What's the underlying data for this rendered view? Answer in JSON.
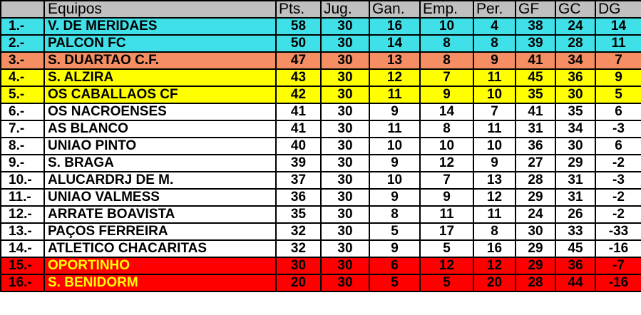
{
  "headers": {
    "pos": "",
    "team": "Equipos",
    "pts": "Pts.",
    "jug": "Jug.",
    "gan": "Gan.",
    "emp": "Emp.",
    "per": "Per.",
    "gf": "GF",
    "gc": "GC",
    "dg": "DG"
  },
  "colors": {
    "cyan": "#3fe0e8",
    "orange": "#f58e62",
    "yellow": "#ffff00",
    "white": "#ffffff",
    "red": "#ff0000",
    "header": "#c0c0c0"
  },
  "rows": [
    {
      "pos": "1.-",
      "team": "V. DE MERIDAES",
      "pts": "58",
      "jug": "30",
      "gan": "16",
      "emp": "10",
      "per": "4",
      "gf": "38",
      "gc": "24",
      "dg": "14",
      "zone": "cyan"
    },
    {
      "pos": "2.-",
      "team": "PALCON FC",
      "pts": "50",
      "jug": "30",
      "gan": "14",
      "emp": "8",
      "per": "8",
      "gf": "39",
      "gc": "28",
      "dg": "11",
      "zone": "cyan"
    },
    {
      "pos": "3.-",
      "team": "S. DUARTAO C.F.",
      "pts": "47",
      "jug": "30",
      "gan": "13",
      "emp": "8",
      "per": "9",
      "gf": "41",
      "gc": "34",
      "dg": "7",
      "zone": "orange"
    },
    {
      "pos": "4.-",
      "team": "S. ALZIRA",
      "pts": "43",
      "jug": "30",
      "gan": "12",
      "emp": "7",
      "per": "11",
      "gf": "45",
      "gc": "36",
      "dg": "9",
      "zone": "yellow"
    },
    {
      "pos": "5.-",
      "team": "OS CABALLAOS CF",
      "pts": "42",
      "jug": "30",
      "gan": "11",
      "emp": "9",
      "per": "10",
      "gf": "35",
      "gc": "30",
      "dg": "5",
      "zone": "yellow"
    },
    {
      "pos": "6.-",
      "team": "OS NACROENSES",
      "pts": "41",
      "jug": "30",
      "gan": "9",
      "emp": "14",
      "per": "7",
      "gf": "41",
      "gc": "35",
      "dg": "6",
      "zone": "white"
    },
    {
      "pos": "7.-",
      "team": "AS BLANCO",
      "pts": "41",
      "jug": "30",
      "gan": "11",
      "emp": "8",
      "per": "11",
      "gf": "31",
      "gc": "34",
      "dg": "-3",
      "zone": "white"
    },
    {
      "pos": "8.-",
      "team": "UNIAO PINTO",
      "pts": "40",
      "jug": "30",
      "gan": "10",
      "emp": "10",
      "per": "10",
      "gf": "36",
      "gc": "30",
      "dg": "6",
      "zone": "white"
    },
    {
      "pos": "9.-",
      "team": "S. BRAGA",
      "pts": "39",
      "jug": "30",
      "gan": "9",
      "emp": "12",
      "per": "9",
      "gf": "27",
      "gc": "29",
      "dg": "-2",
      "zone": "white"
    },
    {
      "pos": "10.-",
      "team": "ALUCARDRJ DE M.",
      "pts": "37",
      "jug": "30",
      "gan": "10",
      "emp": "7",
      "per": "13",
      "gf": "28",
      "gc": "31",
      "dg": "-3",
      "zone": "white"
    },
    {
      "pos": "11.-",
      "team": "UNIAO VALMESS",
      "pts": "36",
      "jug": "30",
      "gan": "9",
      "emp": "9",
      "per": "12",
      "gf": "29",
      "gc": "31",
      "dg": "-2",
      "zone": "white"
    },
    {
      "pos": "12.-",
      "team": "ARRATE BOAVISTA",
      "pts": "35",
      "jug": "30",
      "gan": "8",
      "emp": "11",
      "per": "11",
      "gf": "24",
      "gc": "26",
      "dg": "-2",
      "zone": "white"
    },
    {
      "pos": "13.-",
      "team": "PAÇOS FERREIRA",
      "pts": "32",
      "jug": "30",
      "gan": "5",
      "emp": "17",
      "per": "8",
      "gf": "30",
      "gc": "33",
      "dg": "-33",
      "zone": "white"
    },
    {
      "pos": "14.-",
      "team": "ATLETICO CHACARITAS",
      "pts": "32",
      "jug": "30",
      "gan": "9",
      "emp": "5",
      "per": "16",
      "gf": "29",
      "gc": "45",
      "dg": "-16",
      "zone": "white"
    },
    {
      "pos": "15.-",
      "team": "OPORTINHO",
      "pts": "30",
      "jug": "30",
      "gan": "6",
      "emp": "12",
      "per": "12",
      "gf": "29",
      "gc": "36",
      "dg": "-7",
      "zone": "red"
    },
    {
      "pos": "16.-",
      "team": "S. BENIDORM",
      "pts": "20",
      "jug": "30",
      "gan": "5",
      "emp": "5",
      "per": "20",
      "gf": "28",
      "gc": "44",
      "dg": "-16",
      "zone": "red"
    }
  ]
}
